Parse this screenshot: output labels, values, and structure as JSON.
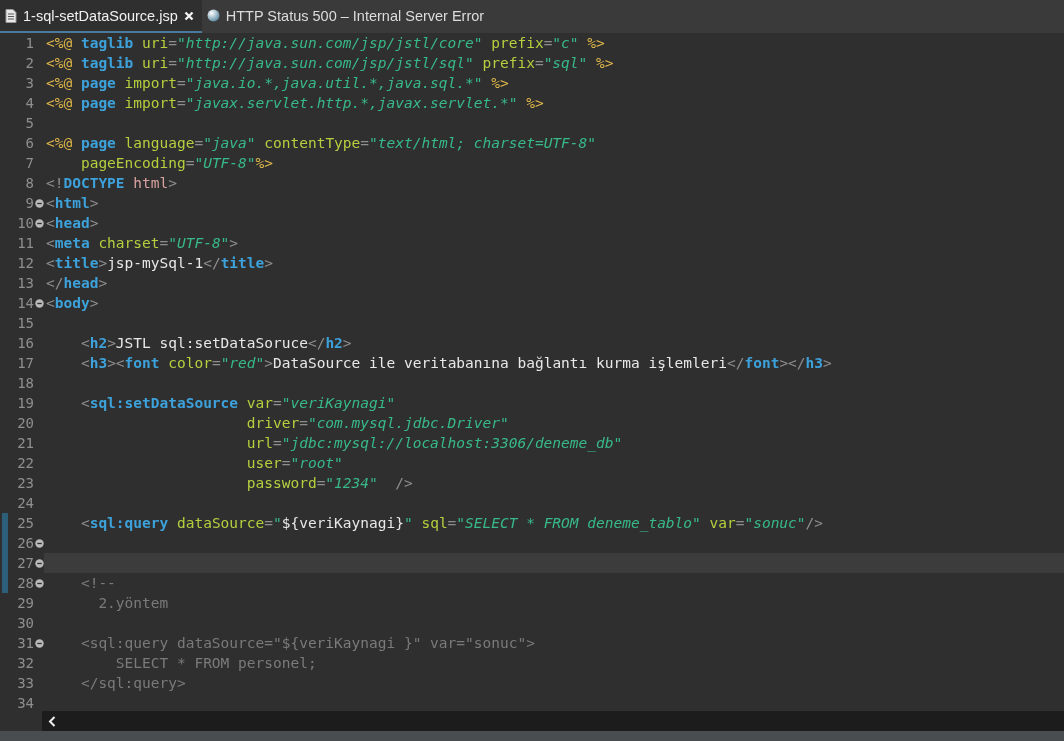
{
  "tabs": [
    {
      "label": "1-sql-setDataSource.jsp",
      "kind": "file",
      "selected": true
    },
    {
      "label": "HTTP Status 500 – Internal Server Error",
      "kind": "browser",
      "selected": false
    }
  ],
  "lines": [
    {
      "number": "1",
      "fold": false,
      "changed": false,
      "current": false,
      "tokens": [
        {
          "kind": "directive",
          "text": "<%@ "
        },
        {
          "kind": "keyword",
          "text": "taglib"
        },
        {
          "kind": "attr",
          "text": " uri"
        },
        {
          "kind": "punct",
          "text": "="
        },
        {
          "kind": "string",
          "text": "\"http://java.sun.com/jsp/jstl/core\""
        },
        {
          "kind": "attr",
          "text": " prefix"
        },
        {
          "kind": "punct",
          "text": "="
        },
        {
          "kind": "string",
          "text": "\"c\""
        },
        {
          "kind": "directive",
          "text": " %>"
        }
      ]
    },
    {
      "number": "2",
      "fold": false,
      "changed": false,
      "current": false,
      "tokens": [
        {
          "kind": "directive",
          "text": "<%@ "
        },
        {
          "kind": "keyword",
          "text": "taglib"
        },
        {
          "kind": "attr",
          "text": " uri"
        },
        {
          "kind": "punct",
          "text": "="
        },
        {
          "kind": "string",
          "text": "\"http://java.sun.com/jsp/jstl/sql\""
        },
        {
          "kind": "attr",
          "text": " prefix"
        },
        {
          "kind": "punct",
          "text": "="
        },
        {
          "kind": "string",
          "text": "\"sql\""
        },
        {
          "kind": "directive",
          "text": " %>"
        }
      ]
    },
    {
      "number": "3",
      "fold": false,
      "changed": false,
      "current": false,
      "tokens": [
        {
          "kind": "directive",
          "text": "<%@ "
        },
        {
          "kind": "keyword",
          "text": "page"
        },
        {
          "kind": "attr",
          "text": " import"
        },
        {
          "kind": "punct",
          "text": "="
        },
        {
          "kind": "string",
          "text": "\"java.io.*,java.util.*,java.sql.*\""
        },
        {
          "kind": "directive",
          "text": " %>"
        }
      ]
    },
    {
      "number": "4",
      "fold": false,
      "changed": false,
      "current": false,
      "tokens": [
        {
          "kind": "directive",
          "text": "<%@ "
        },
        {
          "kind": "keyword",
          "text": "page"
        },
        {
          "kind": "attr",
          "text": " import"
        },
        {
          "kind": "punct",
          "text": "="
        },
        {
          "kind": "string",
          "text": "\"javax.servlet.http.*,javax.servlet.*\""
        },
        {
          "kind": "directive",
          "text": " %>"
        }
      ]
    },
    {
      "number": "5",
      "fold": false,
      "changed": false,
      "current": false
    },
    {
      "number": "6",
      "fold": false,
      "changed": false,
      "current": false,
      "tokens": [
        {
          "kind": "directive",
          "text": "<%@ "
        },
        {
          "kind": "keyword",
          "text": "page"
        },
        {
          "kind": "attr",
          "text": " language"
        },
        {
          "kind": "punct",
          "text": "="
        },
        {
          "kind": "string",
          "text": "\"java\""
        },
        {
          "kind": "attr",
          "text": " contentType"
        },
        {
          "kind": "punct",
          "text": "="
        },
        {
          "kind": "string",
          "text": "\"text/html; charset=UTF-8\""
        }
      ]
    },
    {
      "number": "7",
      "fold": false,
      "changed": false,
      "current": false,
      "tokens": [
        {
          "kind": "attr",
          "text": "    pageEncoding"
        },
        {
          "kind": "punct",
          "text": "="
        },
        {
          "kind": "string",
          "text": "\"UTF-8\""
        },
        {
          "kind": "directive",
          "text": "%>"
        }
      ]
    },
    {
      "number": "8",
      "fold": false,
      "changed": false,
      "current": false,
      "tokens": [
        {
          "kind": "punct",
          "text": "<!"
        },
        {
          "kind": "keyword",
          "text": "DOCTYPE"
        },
        {
          "kind": "doctype",
          "text": " html"
        },
        {
          "kind": "punct",
          "text": ">"
        }
      ]
    },
    {
      "number": "9",
      "fold": true,
      "changed": false,
      "current": false,
      "tokens": [
        {
          "kind": "punct",
          "text": "<"
        },
        {
          "kind": "keyword",
          "text": "html"
        },
        {
          "kind": "punct",
          "text": ">"
        }
      ]
    },
    {
      "number": "10",
      "fold": true,
      "changed": false,
      "current": false,
      "tokens": [
        {
          "kind": "punct",
          "text": "<"
        },
        {
          "kind": "keyword",
          "text": "head"
        },
        {
          "kind": "punct",
          "text": ">"
        }
      ]
    },
    {
      "number": "11",
      "fold": false,
      "changed": false,
      "current": false,
      "tokens": [
        {
          "kind": "punct",
          "text": "<"
        },
        {
          "kind": "keyword",
          "text": "meta"
        },
        {
          "kind": "attr",
          "text": " charset"
        },
        {
          "kind": "punct",
          "text": "="
        },
        {
          "kind": "string",
          "text": "\"UTF-8\""
        },
        {
          "kind": "punct",
          "text": ">"
        }
      ]
    },
    {
      "number": "12",
      "fold": false,
      "changed": false,
      "current": false,
      "tokens": [
        {
          "kind": "punct",
          "text": "<"
        },
        {
          "kind": "keyword",
          "text": "title"
        },
        {
          "kind": "punct",
          "text": ">"
        },
        {
          "kind": "text",
          "text": "jsp-mySql-1"
        },
        {
          "kind": "punct",
          "text": "</"
        },
        {
          "kind": "keyword",
          "text": "title"
        },
        {
          "kind": "punct",
          "text": ">"
        }
      ]
    },
    {
      "number": "13",
      "fold": false,
      "changed": false,
      "current": false,
      "tokens": [
        {
          "kind": "punct",
          "text": "</"
        },
        {
          "kind": "keyword",
          "text": "head"
        },
        {
          "kind": "punct",
          "text": ">"
        }
      ]
    },
    {
      "number": "14",
      "fold": true,
      "changed": false,
      "current": false,
      "tokens": [
        {
          "kind": "punct",
          "text": "<"
        },
        {
          "kind": "keyword",
          "text": "body"
        },
        {
          "kind": "punct",
          "text": ">"
        }
      ]
    },
    {
      "number": "15",
      "fold": false,
      "changed": false,
      "current": false
    },
    {
      "number": "16",
      "fold": false,
      "changed": false,
      "current": false,
      "tokens": [
        {
          "kind": "punct",
          "text": "    <"
        },
        {
          "kind": "keyword",
          "text": "h2"
        },
        {
          "kind": "punct",
          "text": ">"
        },
        {
          "kind": "text",
          "text": "JSTL sql:setDataSoruce"
        },
        {
          "kind": "punct",
          "text": "</"
        },
        {
          "kind": "keyword",
          "text": "h2"
        },
        {
          "kind": "punct",
          "text": ">"
        }
      ]
    },
    {
      "number": "17",
      "fold": false,
      "changed": false,
      "current": false,
      "tokens": [
        {
          "kind": "punct",
          "text": "    <"
        },
        {
          "kind": "keyword",
          "text": "h3"
        },
        {
          "kind": "punct",
          "text": "><"
        },
        {
          "kind": "keyword",
          "text": "font"
        },
        {
          "kind": "attr",
          "text": " color"
        },
        {
          "kind": "punct",
          "text": "="
        },
        {
          "kind": "string",
          "text": "\"red\""
        },
        {
          "kind": "punct",
          "text": ">"
        },
        {
          "kind": "text",
          "text": "DataSource ile veritabanına bağlantı kurma işlemleri"
        },
        {
          "kind": "punct",
          "text": "</"
        },
        {
          "kind": "keyword",
          "text": "font"
        },
        {
          "kind": "punct",
          "text": "></"
        },
        {
          "kind": "keyword",
          "text": "h3"
        },
        {
          "kind": "punct",
          "text": ">"
        }
      ]
    },
    {
      "number": "18",
      "fold": false,
      "changed": false,
      "current": false
    },
    {
      "number": "19",
      "fold": false,
      "changed": false,
      "current": false,
      "tokens": [
        {
          "kind": "punct",
          "text": "    <"
        },
        {
          "kind": "keyword",
          "text": "sql:setDataSource"
        },
        {
          "kind": "attr",
          "text": " var"
        },
        {
          "kind": "punct",
          "text": "="
        },
        {
          "kind": "string",
          "text": "\"veriKaynagi\""
        }
      ]
    },
    {
      "number": "20",
      "fold": false,
      "changed": false,
      "current": false,
      "tokens": [
        {
          "kind": "attr",
          "text": "                       driver"
        },
        {
          "kind": "punct",
          "text": "="
        },
        {
          "kind": "string",
          "text": "\"com.mysql.jdbc.Driver\""
        }
      ]
    },
    {
      "number": "21",
      "fold": false,
      "changed": false,
      "current": false,
      "tokens": [
        {
          "kind": "attr",
          "text": "                       url"
        },
        {
          "kind": "punct",
          "text": "="
        },
        {
          "kind": "string",
          "text": "\"jdbc:mysql://localhost:3306/deneme_db\""
        }
      ]
    },
    {
      "number": "22",
      "fold": false,
      "changed": false,
      "current": false,
      "tokens": [
        {
          "kind": "attr",
          "text": "                       user"
        },
        {
          "kind": "punct",
          "text": "="
        },
        {
          "kind": "string",
          "text": "\"root\""
        }
      ]
    },
    {
      "number": "23",
      "fold": false,
      "changed": false,
      "current": false,
      "tokens": [
        {
          "kind": "attr",
          "text": "                       password"
        },
        {
          "kind": "punct",
          "text": "="
        },
        {
          "kind": "string",
          "text": "\"1234\""
        },
        {
          "kind": "punct",
          "text": "  />"
        }
      ]
    },
    {
      "number": "24",
      "fold": false,
      "changed": false,
      "current": false
    },
    {
      "number": "25",
      "fold": false,
      "changed": true,
      "current": false,
      "tokens": [
        {
          "kind": "punct",
          "text": "    <"
        },
        {
          "kind": "keyword",
          "text": "sql:query"
        },
        {
          "kind": "attr",
          "text": " dataSource"
        },
        {
          "kind": "punct",
          "text": "="
        },
        {
          "kind": "string",
          "text": "\""
        },
        {
          "kind": "text",
          "text": "${veriKaynagi}"
        },
        {
          "kind": "string",
          "text": "\""
        },
        {
          "kind": "attr",
          "text": " sql"
        },
        {
          "kind": "punct",
          "text": "="
        },
        {
          "kind": "string",
          "text": "\"SELECT * FROM deneme_tablo\""
        },
        {
          "kind": "attr",
          "text": " var"
        },
        {
          "kind": "punct",
          "text": "="
        },
        {
          "kind": "string",
          "text": "\"sonuc\""
        },
        {
          "kind": "punct",
          "text": "/>"
        }
      ]
    },
    {
      "number": "26",
      "fold": true,
      "changed": true,
      "current": false
    },
    {
      "number": "27",
      "fold": true,
      "changed": true,
      "current": true
    },
    {
      "number": "28",
      "fold": true,
      "changed": true,
      "current": false,
      "tokens": [
        {
          "kind": "comment",
          "text": "    <!--"
        }
      ]
    },
    {
      "number": "29",
      "fold": false,
      "changed": false,
      "current": false,
      "tokens": [
        {
          "kind": "comment",
          "text": "      2.yöntem"
        }
      ]
    },
    {
      "number": "30",
      "fold": false,
      "changed": false,
      "current": false
    },
    {
      "number": "31",
      "fold": true,
      "changed": false,
      "current": false,
      "tokens": [
        {
          "kind": "comment",
          "text": "    <sql:query dataSource=\"${veriKaynagi }\" var=\"sonuc\">"
        }
      ]
    },
    {
      "number": "32",
      "fold": false,
      "changed": false,
      "current": false,
      "tokens": [
        {
          "kind": "comment",
          "text": "        SELECT * FROM personel;"
        }
      ]
    },
    {
      "number": "33",
      "fold": false,
      "changed": false,
      "current": false,
      "tokens": [
        {
          "kind": "comment",
          "text": "    </sql:query>"
        }
      ]
    },
    {
      "number": "34",
      "fold": false,
      "changed": false,
      "current": false
    }
  ]
}
